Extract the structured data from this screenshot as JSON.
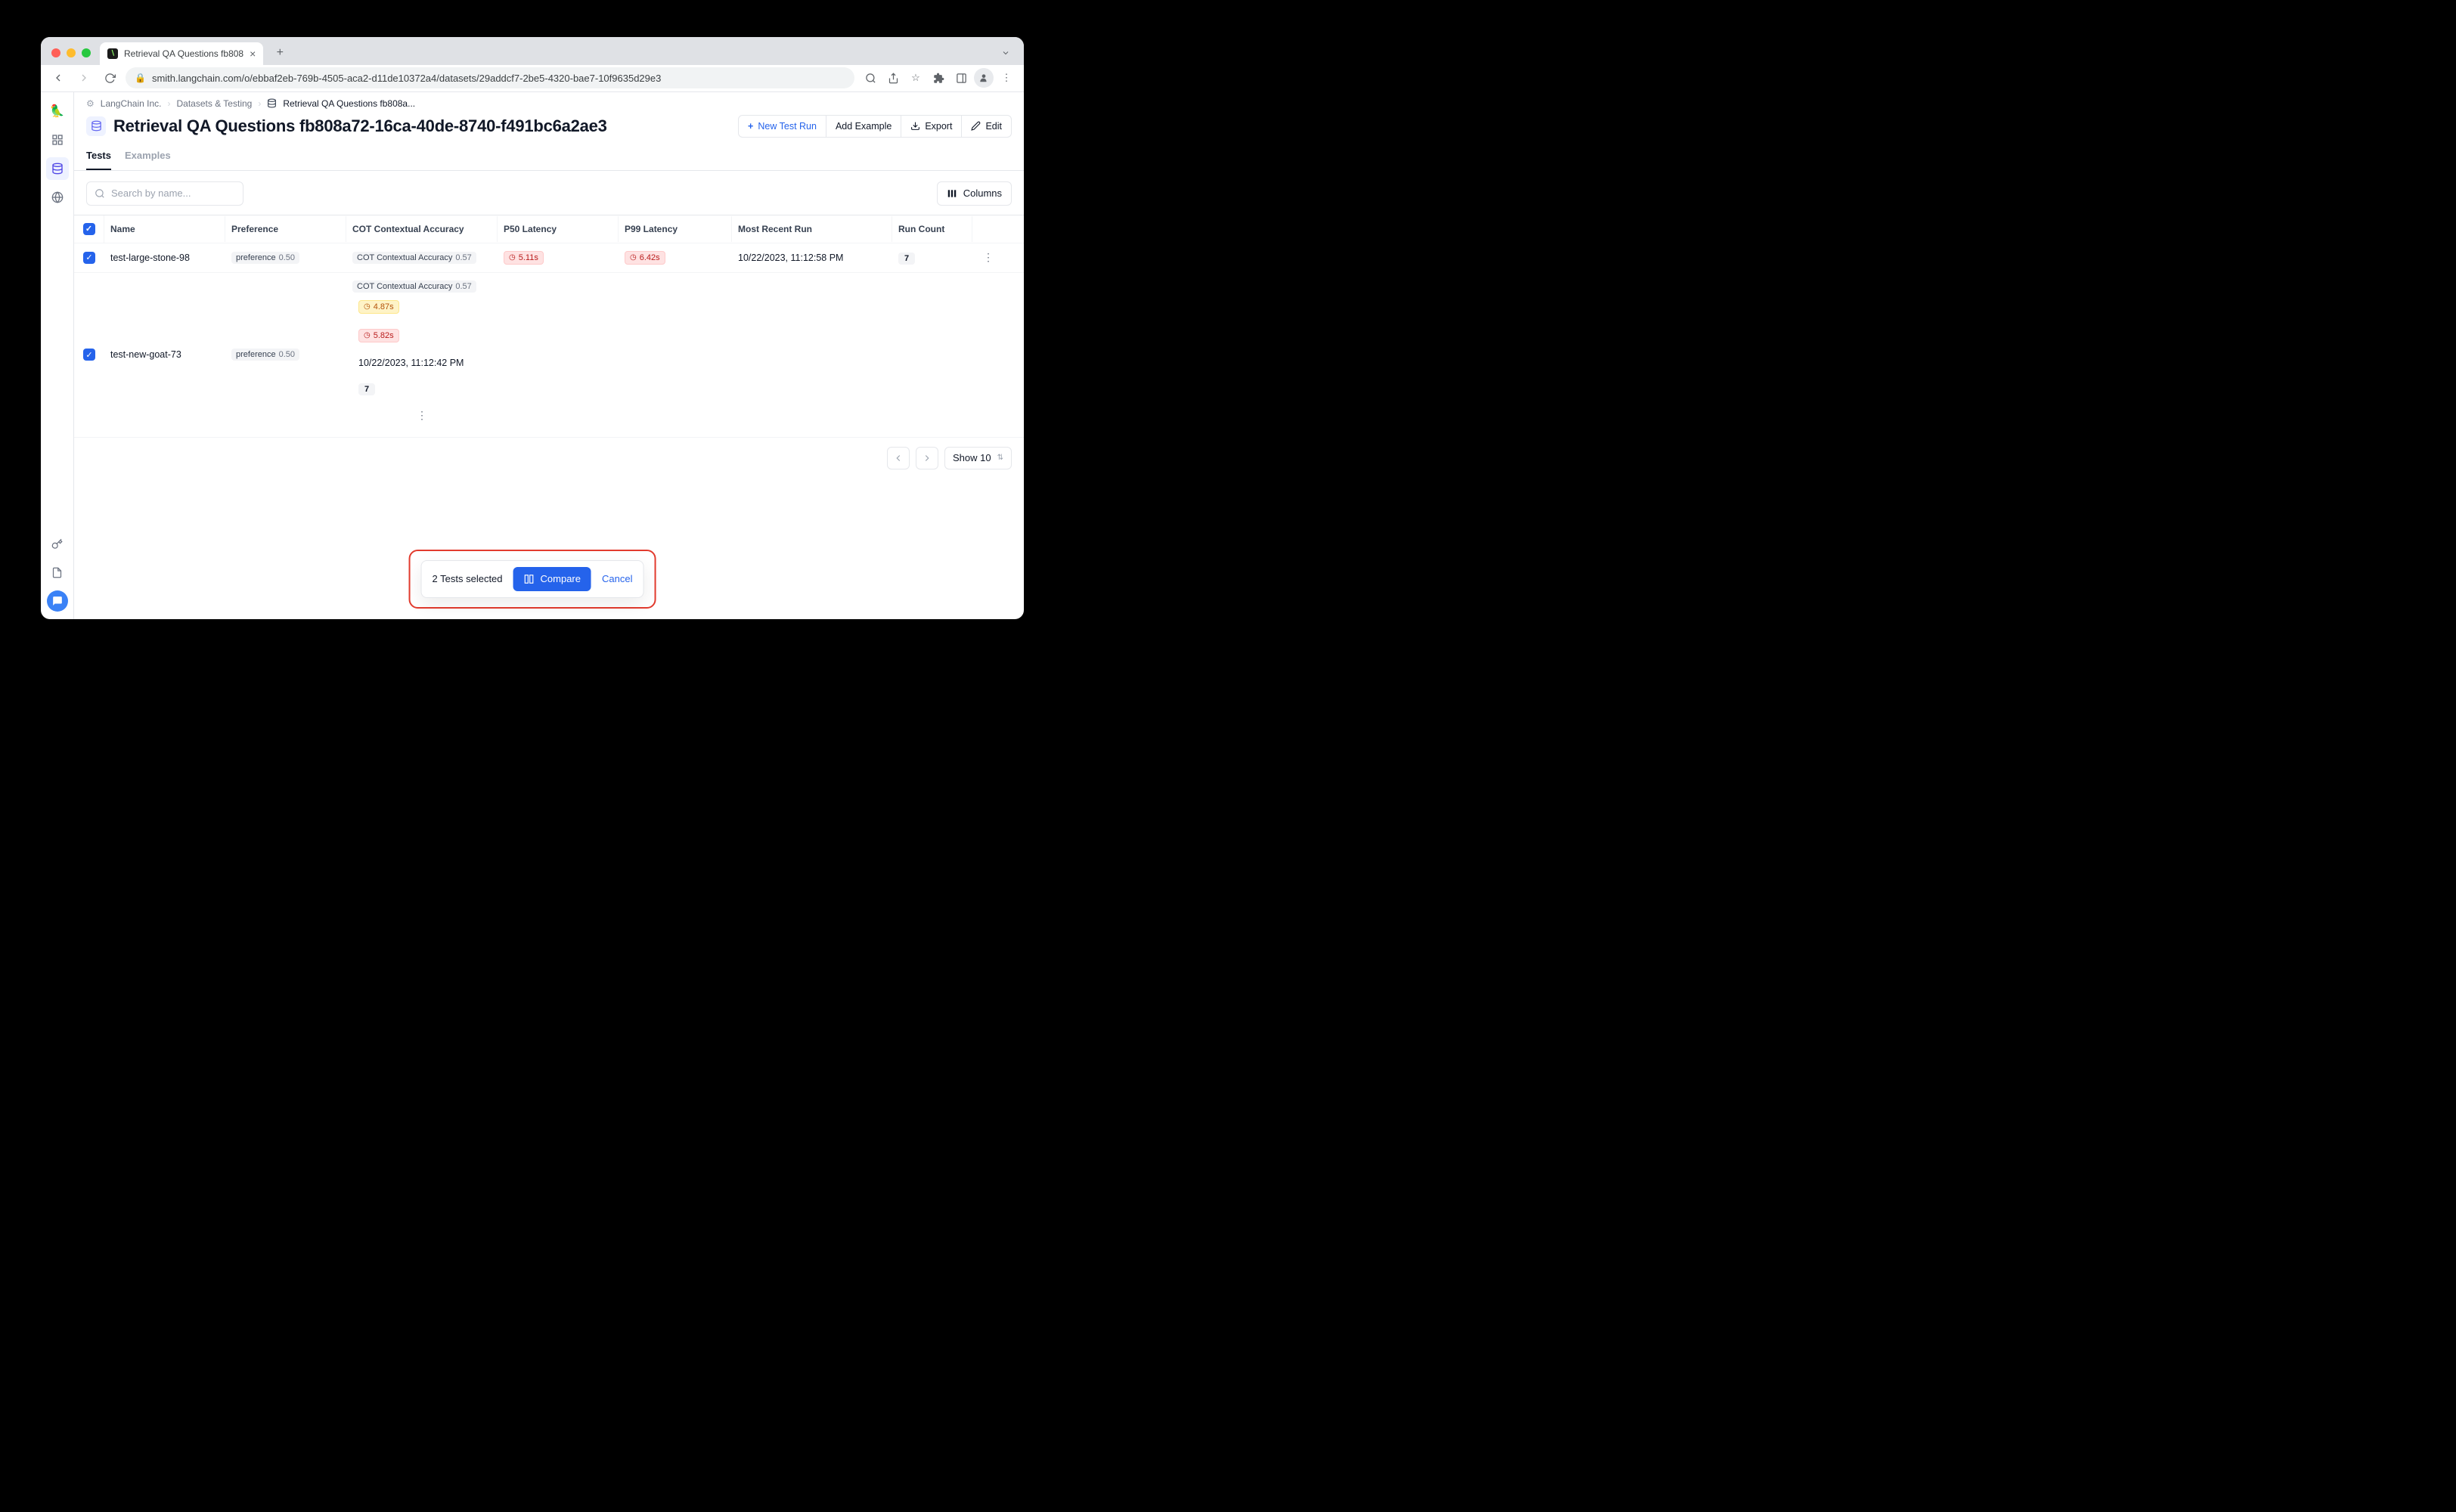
{
  "tab": {
    "title": "Retrieval QA Questions fb808"
  },
  "address": "smith.langchain.com/o/ebbaf2eb-769b-4505-aca2-d11de10372a4/datasets/29addcf7-2be5-4320-bae7-10f9635d29e3",
  "breadcrumb": {
    "org": "LangChain Inc.",
    "section": "Datasets & Testing",
    "page": "Retrieval QA Questions fb808a..."
  },
  "page": {
    "title": "Retrieval QA Questions fb808a72-16ca-40de-8740-f491bc6a2ae3"
  },
  "actions": {
    "newTest": "New Test Run",
    "addExample": "Add Example",
    "export": "Export",
    "edit": "Edit"
  },
  "tabs": {
    "tests": "Tests",
    "examples": "Examples"
  },
  "search": {
    "placeholder": "Search by name..."
  },
  "columnsBtn": "Columns",
  "columns": {
    "name": "Name",
    "preference": "Preference",
    "cot": "COT Contextual Accuracy",
    "p50": "P50 Latency",
    "p99": "P99 Latency",
    "recent": "Most Recent Run",
    "runCount": "Run Count"
  },
  "rows": [
    {
      "name": "test-large-stone-98",
      "prefLabel": "preference",
      "prefVal": "0.50",
      "cotLabel": "COT Contextual Accuracy",
      "cotVal": "0.57",
      "p50": "5.11s",
      "p99": "6.42s",
      "recent": "10/22/2023, 11:12:58 PM",
      "count": "7"
    },
    {
      "name": "test-new-goat-73",
      "prefLabel": "preference",
      "prefVal": "0.50",
      "cotLabel": "COT Contextual Accuracy",
      "cotVal": "0.57",
      "p50": "4.87s",
      "p99": "5.82s",
      "recent": "10/22/2023, 11:12:42 PM",
      "count": "7"
    }
  ],
  "pagination": {
    "show": "Show 10"
  },
  "selection": {
    "label": "2 Tests selected",
    "compare": "Compare",
    "cancel": "Cancel"
  }
}
